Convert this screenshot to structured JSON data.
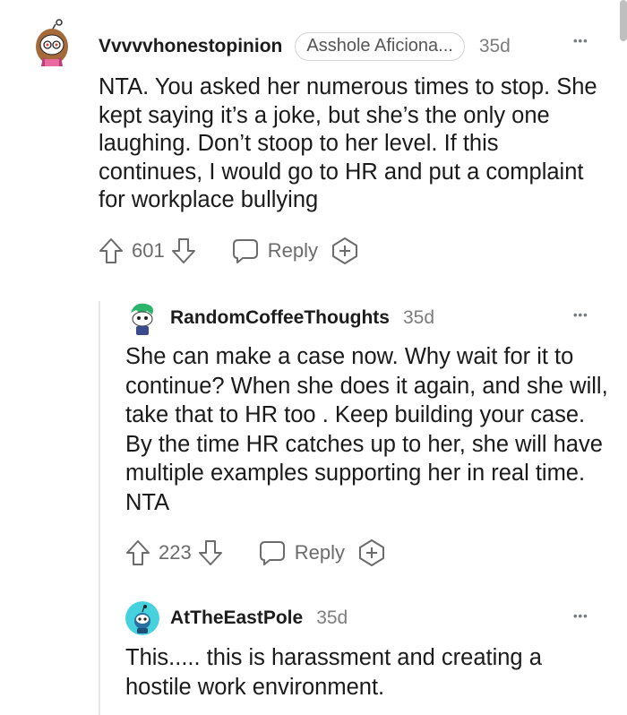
{
  "comments": [
    {
      "username": "Vvvvvhonestopinion",
      "flair": "Asshole Aficiona...",
      "age": "35d",
      "more": "•••",
      "body": "NTA. You asked her numerous times to stop. She kept saying it’s a joke, but she’s the only one laughing. Don’t stoop to her level. If this continues, I would go to HR and put a complaint for workplace bullying",
      "score": "601",
      "reply_label": "Reply"
    },
    {
      "username": "RandomCoffeeThoughts",
      "age": "35d",
      "more": "•••",
      "body": "She can make a case now. Why wait for it to continue? When she does it again, and she will, take that to HR too . Keep building your case. By the time HR catches up to her, she will have multiple examples supporting her in real time. NTA",
      "score": "223",
      "reply_label": "Reply"
    },
    {
      "username": "AtTheEastPole",
      "age": "35d",
      "more": "•••",
      "body": "This..... this is harassment and creating a hostile work environment."
    }
  ],
  "icons": {
    "upvote": "upvote-arrow-icon",
    "downvote": "downvote-arrow-icon",
    "reply": "speech-bubble-icon",
    "award": "add-award-icon",
    "more": "ellipsis-icon"
  },
  "colors": {
    "text": "#1a1a1b",
    "muted": "#7c7c7c",
    "avatar2_bg": "#ffffff",
    "avatar3_bg": "#46d1df"
  }
}
